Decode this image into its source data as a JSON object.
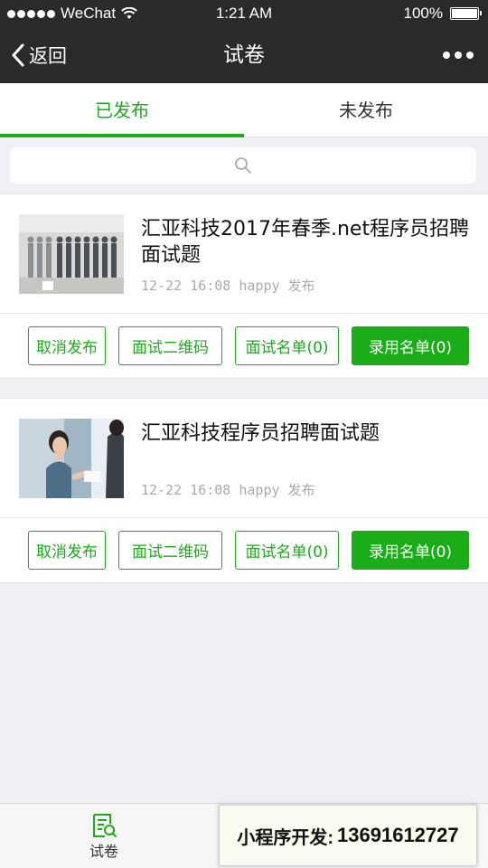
{
  "status_bar": {
    "carrier": "WeChat",
    "time": "1:21 AM",
    "battery": "100%"
  },
  "nav": {
    "back_label": "返回",
    "title": "试卷"
  },
  "tabs": [
    {
      "label": "已发布",
      "active": true
    },
    {
      "label": "未发布",
      "active": false
    }
  ],
  "search": {
    "placeholder": ""
  },
  "cards": [
    {
      "title": "汇亚科技2017年春季.net程序员招聘面试题",
      "meta": "12-22 16:08 happy 发布",
      "thumb_icon": "job-candidates-image",
      "actions": [
        "取消发布",
        "面试二维码",
        "面试名单(0)",
        "录用名单(0)"
      ]
    },
    {
      "title": "汇亚科技程序员招聘面试题",
      "meta": "12-22 16:08 happy 发布",
      "thumb_icon": "handshake-interview-image",
      "actions": [
        "取消发布",
        "面试二维码",
        "面试名单(0)",
        "录用名单(0)"
      ]
    }
  ],
  "tabbar": {
    "items": [
      {
        "label": "试卷",
        "icon": "document-search-icon"
      }
    ]
  },
  "promo": {
    "label": "小程序开发:",
    "number": "13691612727"
  },
  "colors": {
    "accent": "#1aad19",
    "navbar": "#2a2a2a",
    "background": "#efeff4"
  }
}
